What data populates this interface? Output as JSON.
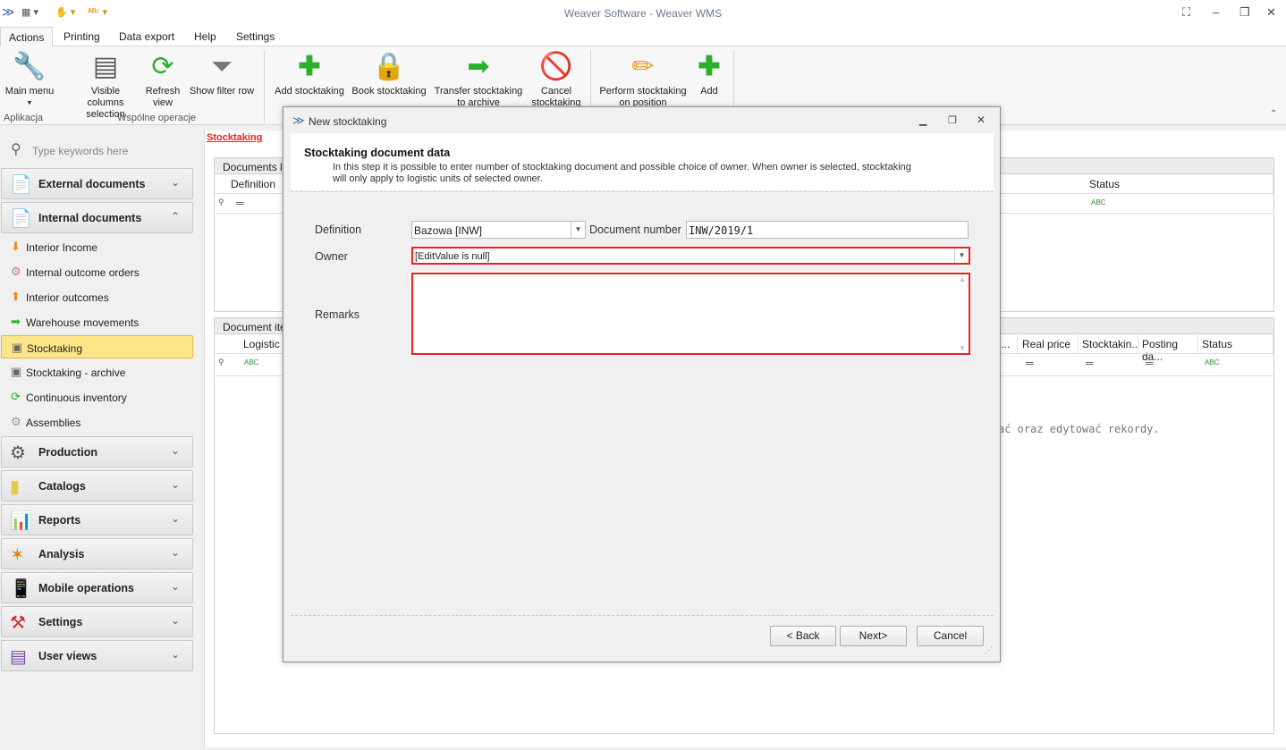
{
  "window": {
    "title": "Weaver Software - Weaver WMS"
  },
  "tabs": [
    "Actions",
    "Printing",
    "Data export",
    "Help",
    "Settings"
  ],
  "ribbon": {
    "main_menu": "Main menu",
    "visible_columns_1": "Visible columns",
    "visible_columns_2": "selection",
    "refresh_1": "Refresh",
    "refresh_2": "view",
    "show_filter_row": "Show filter row",
    "add_stocktaking": "Add stocktaking",
    "book_stocktaking": "Book stocktaking",
    "transfer_1": "Transfer stocktaking",
    "transfer_2": "to archive",
    "cancel_1": "Cancel",
    "cancel_2": "stocktaking",
    "perform_1": "Perform stocktaking",
    "perform_2": "on position",
    "add": "Add",
    "group_aplikacja": "Aplikacja",
    "group_wspolne": "Wspólne operacje"
  },
  "sidebar": {
    "search_placeholder": "Type keywords here",
    "external_documents": "External documents",
    "internal_documents": "Internal documents",
    "items": [
      "Interior Income",
      "Internal outcome orders",
      "Interior outcomes",
      "Warehouse movements",
      "Stocktaking",
      "Stocktaking - archive",
      "Continuous inventory",
      "Assemblies"
    ],
    "groups": [
      "Production",
      "Catalogs",
      "Reports",
      "Analysis",
      "Mobile operations",
      "Settings",
      "User views"
    ]
  },
  "main": {
    "breadcrumb": "Stocktaking",
    "documents_list": "Documents lis",
    "col_definition": "Definition",
    "col_status": "Status",
    "document_items": "Document iter",
    "col_logistic": "Logistic u",
    "col_t": "t...",
    "col_real_price": "Real price",
    "col_stocktaking": "Stocktakin...",
    "col_posting_date": "Posting da...",
    "col_status2": "Status",
    "empty_hint": "ać oraz edytować rekordy.",
    "abc": "ABC"
  },
  "dialog": {
    "title": "New stocktaking",
    "heading": "Stocktaking document data",
    "desc_1": "In this step it is possible to enter number of stocktaking document and possible choice of owner. When owner is selected, stocktaking",
    "desc_2": "will only apply to logistic units of selected owner.",
    "definition_label": "Definition",
    "definition_value": "Bazowa [INW]",
    "document_number_label": "Document number",
    "document_number_value": "INW/2019/1",
    "owner_label": "Owner",
    "owner_value": "[EditValue is null]",
    "remarks_label": "Remarks",
    "back": "< Back",
    "next": "Next>",
    "cancel": "Cancel"
  },
  "colors": {
    "accent": "#e8231f",
    "selected": "#fde68a",
    "title": "#6c7a8c"
  }
}
